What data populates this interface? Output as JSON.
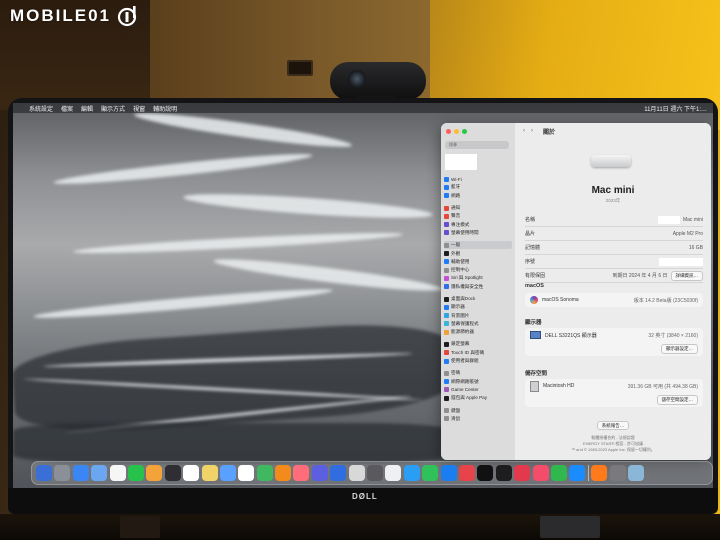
{
  "watermark": {
    "text": "MOBILE01"
  },
  "menubar": {
    "items": [
      "",
      "系統設定",
      "檔案",
      "編輯",
      "顯示方式",
      "視窗",
      "輔助說明"
    ],
    "clock": "11月11日 週六 下午1:…"
  },
  "window": {
    "search_placeholder": "搜尋",
    "sidebar_groups": [
      [
        {
          "label": "Wi-Fi",
          "color": "#1f7cf2"
        },
        {
          "label": "藍牙",
          "color": "#1f7cf2"
        },
        {
          "label": "網路",
          "color": "#1f7cf2"
        }
      ],
      [
        {
          "label": "通知",
          "color": "#e8453c"
        },
        {
          "label": "聲音",
          "color": "#e8453c"
        },
        {
          "label": "專注模式",
          "color": "#6a4ccf"
        },
        {
          "label": "螢幕使用時間",
          "color": "#6a4ccf"
        }
      ],
      [
        {
          "label": "一般",
          "color": "#8e8e93",
          "active": true
        },
        {
          "label": "外觀",
          "color": "#1d1d1f"
        },
        {
          "label": "輔助使用",
          "color": "#1f7cf2"
        },
        {
          "label": "控制中心",
          "color": "#8e8e93"
        },
        {
          "label": "Siri 與 Spotlight",
          "color": "#c44fd6"
        },
        {
          "label": "隱私權與安全性",
          "color": "#2e6ee6"
        }
      ],
      [
        {
          "label": "桌面與Dock",
          "color": "#1d1d1f"
        },
        {
          "label": "顯示器",
          "color": "#1f7cf2"
        },
        {
          "label": "背景圖片",
          "color": "#2fa6e0"
        },
        {
          "label": "螢幕保護程式",
          "color": "#36b5d8"
        },
        {
          "label": "能源節約器",
          "color": "#f0a13a"
        }
      ],
      [
        {
          "label": "鎖定螢幕",
          "color": "#1d1d1f"
        },
        {
          "label": "Touch ID 與密碼",
          "color": "#e8453c"
        },
        {
          "label": "使用者與群組",
          "color": "#1f7cf2"
        }
      ],
      [
        {
          "label": "密碼",
          "color": "#8e8e93"
        },
        {
          "label": "網際網路帳號",
          "color": "#1f7cf2"
        },
        {
          "label": "Game Center",
          "color": "#9b59b6"
        },
        {
          "label": "錢包與 Apple Pay",
          "color": "#1d1d1f"
        }
      ],
      [
        {
          "label": "鍵盤",
          "color": "#8e8e93"
        },
        {
          "label": "滑鼠",
          "color": "#8e8e93"
        }
      ]
    ],
    "main_title": "關於",
    "device_name": "Mac mini",
    "device_year": "2023年",
    "info_rows": [
      {
        "key": "名稱",
        "value": "Mac mini",
        "redacted": true
      },
      {
        "key": "晶片",
        "value": "Apple M2 Pro"
      },
      {
        "key": "記憶體",
        "value": "16 GB"
      },
      {
        "key": "序號",
        "value": "",
        "redacted": true
      },
      {
        "key": "有限保固",
        "value": "到期日 2024 年 4 月 6 日",
        "button": "詳細資訊…"
      }
    ],
    "macos_header": "macOS",
    "macos_name": "macOS Sonoma",
    "macos_version": "版本 14.2 Beta版 (23C5030f)",
    "displays_header": "顯示器",
    "display_name": "DELL S3221QS 顯示器",
    "display_size": "32 英寸 (3840 × 2160)",
    "display_button": "顯示器設定…",
    "storage_header": "儲存空間",
    "storage_name": "Macintosh HD",
    "storage_value": "391.36 GB 可用 (共 494.38 GB)",
    "storage_button": "儲存空間設定…",
    "report_button": "系統報告…",
    "footer_line1": "軟體授權合約 - 法規認證",
    "footer_line2": "ENERGY STAR® 相容 - 許可協議",
    "footer_line3": "™ and © 1983-2023 Apple Inc. 保留一切權利。"
  },
  "dock": {
    "icon_colors": [
      "#3a6fd8",
      "#8a8f98",
      "#3b86f5",
      "#6aa7f0",
      "#f6f6f6",
      "#27c24c",
      "#f3a33a",
      "#2f2f33",
      "#ffffff",
      "#f0d46a",
      "#5aa0ff",
      "#ffffff",
      "#3fb85f",
      "#f28a1c",
      "#ff6d7a",
      "#5b5fe0",
      "#2f6de0",
      "#d8d8d8",
      "#5a5a5e",
      "#eef0f3",
      "#2a9df4",
      "#30c15a",
      "#1a7ef2",
      "#e7434a",
      "#111111",
      "#1d1d1f",
      "#e2394d",
      "#f44c6b",
      "#30b84f",
      "#1a8cff",
      "#ff7a1a",
      "#7a7a7e",
      "#8ab7d8"
    ]
  },
  "monitor": {
    "brand": "DØLL"
  }
}
